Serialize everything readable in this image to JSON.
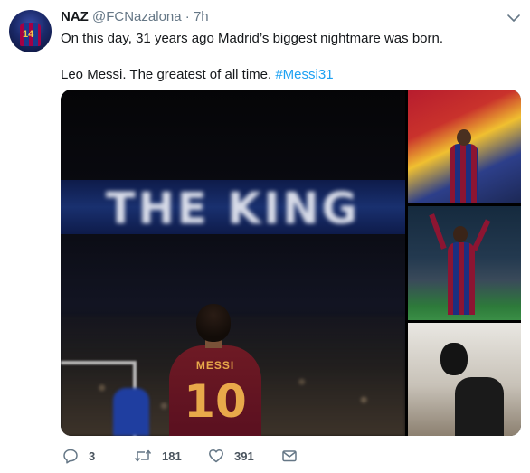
{
  "tweet": {
    "author_name": "NAZ",
    "handle": "@FCNazalona",
    "separator": "·",
    "time": "7h",
    "text_line1": "On this day, 31 years ago Madrid’s biggest nightmare was born.",
    "text_line2_prefix": "Leo Messi. The greatest of all time. ",
    "hashtag": "#Messi31",
    "avatar_number": "14"
  },
  "media": {
    "main_banner_text": "THE KING",
    "main_shirt_name": "MESSI",
    "main_shirt_number": "10"
  },
  "actions": {
    "reply_count": "3",
    "retweet_count": "181",
    "like_count": "391"
  },
  "icons": {
    "menu": "chevron-down-icon",
    "reply": "reply-icon",
    "retweet": "retweet-icon",
    "like": "heart-icon",
    "message": "envelope-icon"
  },
  "colors": {
    "link": "#1da1f2",
    "secondary_text": "#657786",
    "primary_text": "#14171a"
  }
}
